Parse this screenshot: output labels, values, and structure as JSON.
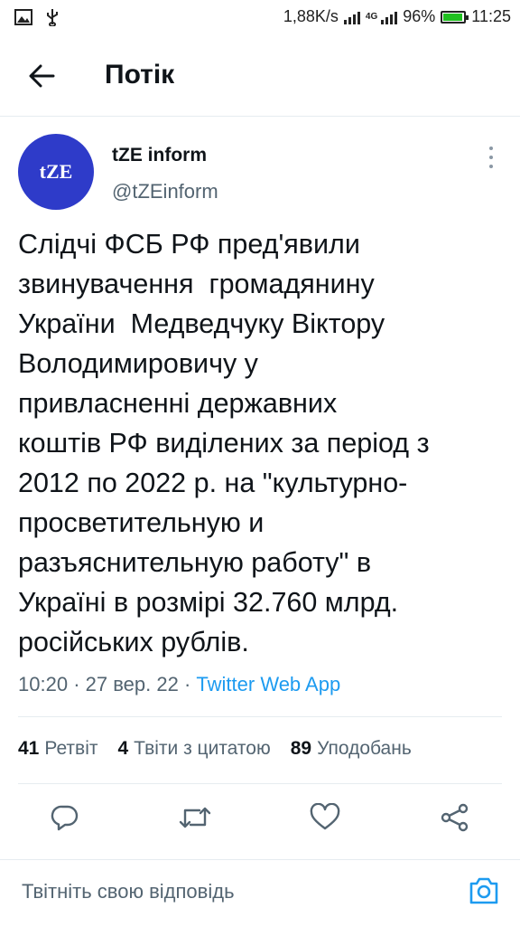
{
  "status_bar": {
    "speed": "1,88K/s",
    "network": "4G",
    "battery_percent": "96%",
    "battery_level": 0.96,
    "time": "11:25"
  },
  "header": {
    "title": "Потік"
  },
  "tweet": {
    "avatar_text": "tZE",
    "author_name": "tZE inform",
    "author_handle": "@tZEinform",
    "text": "Слідчі ФСБ РФ пред'явили\nзвинувачення  громадянину\nУкраїни  Медведчуку Віктору\nВолодимировичу у\nпривласненні державних\nкоштів РФ виділених за період з\n2012 по 2022 р. на \"культурно-\nпросветительную и\nразъяснительную работу\" в\nУкраїні в розмірі 32.760 млрд.\nросійських рублів.",
    "time": "10:20",
    "date": "27 вер. 22",
    "separator": "·",
    "source": "Twitter Web App"
  },
  "stats": {
    "retweets_count": "41",
    "retweets_label": "Ретвіт",
    "quotes_count": "4",
    "quotes_label": "Твіти з цитатою",
    "likes_count": "89",
    "likes_label": "Уподобань"
  },
  "reply": {
    "placeholder": "Твітніть свою відповідь"
  },
  "colors": {
    "avatar_bg": "#2e3bc9",
    "link": "#1d9bf0",
    "icon": "#536471"
  }
}
